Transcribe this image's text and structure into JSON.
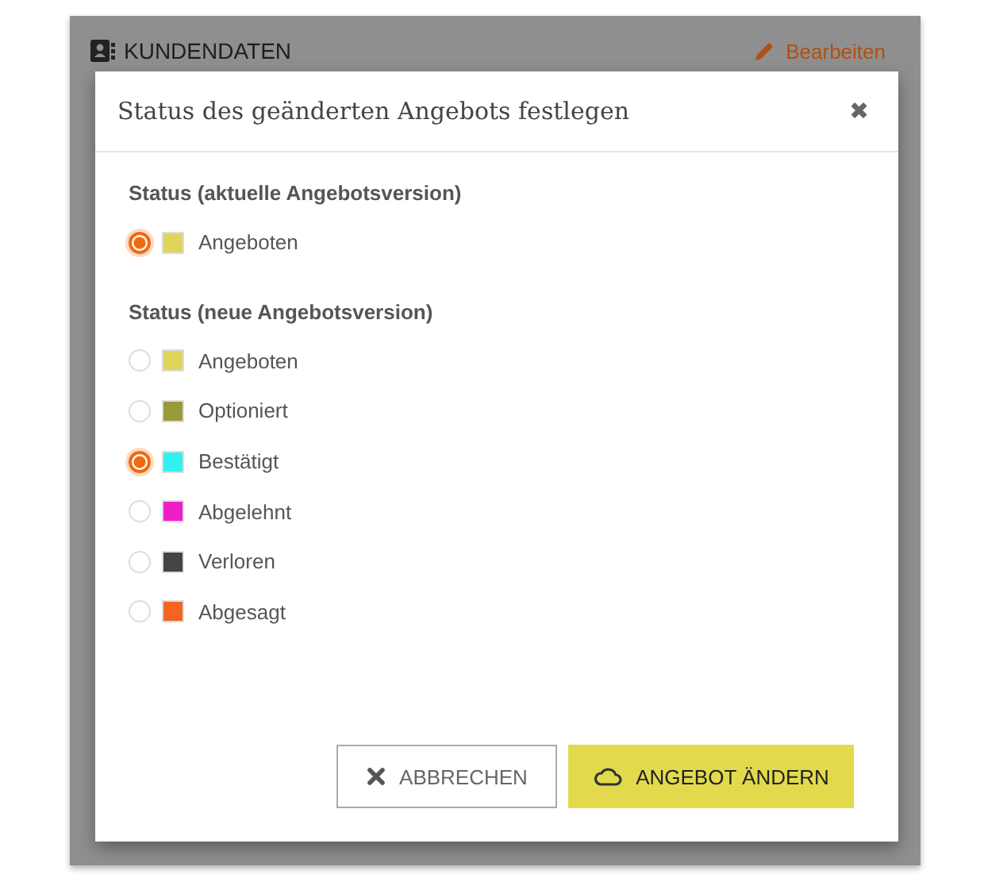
{
  "background_panel": {
    "title": "KUNDENDATEN",
    "edit_link": "Bearbeiten"
  },
  "dialog": {
    "title": "Status des geänderten Angebots festlegen",
    "close": "✖",
    "groups": [
      {
        "heading": "Status (aktuelle Angebotsversion)",
        "options": [
          {
            "label": "Angeboten",
            "color": "#e0d45a",
            "selected": true
          }
        ]
      },
      {
        "heading": "Status (neue Angebotsversion)",
        "options": [
          {
            "label": "Angeboten",
            "color": "#e0d45a",
            "selected": false
          },
          {
            "label": "Optioniert",
            "color": "#9a9a3a",
            "selected": false
          },
          {
            "label": "Bestätigt",
            "color": "#33f0f0",
            "selected": true
          },
          {
            "label": "Abgelehnt",
            "color": "#f01ec8",
            "selected": false
          },
          {
            "label": "Verloren",
            "color": "#444444",
            "selected": false
          },
          {
            "label": "Abgesagt",
            "color": "#f26522",
            "selected": false
          }
        ]
      }
    ],
    "buttons": [
      {
        "kind": "secondary",
        "label": "ABBRECHEN"
      },
      {
        "kind": "primary",
        "label": "ANGEBOT ÄNDERN"
      }
    ]
  }
}
